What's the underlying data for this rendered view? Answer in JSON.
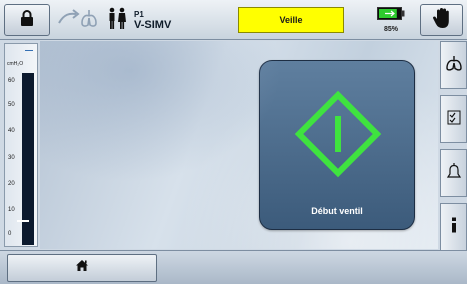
{
  "header": {
    "patient": "P1",
    "mode": "V-SIMV",
    "status": "Veille",
    "battery_percent": "85%",
    "battery_level": 0.85
  },
  "gauge": {
    "unit": "cmH₂O",
    "ticks": [
      "60",
      "50",
      "40",
      "30",
      "20",
      "10",
      "0"
    ],
    "current_value": 0
  },
  "main": {
    "start_label": "Début ventil"
  },
  "colors": {
    "status_bg": "#ffff00",
    "start_icon": "#3fe33f",
    "start_button": "#4d6d8d"
  },
  "icons": {
    "lock": "lock-icon",
    "lung_trigger": "lung-trigger-icon",
    "patient": "patient-icon",
    "battery": "battery-icon",
    "alarm_silence": "hand-icon",
    "lungs": "lungs-icon",
    "checklist": "checklist-icon",
    "alarm": "bell-icon",
    "info": "info-icon",
    "home": "home-icon"
  }
}
